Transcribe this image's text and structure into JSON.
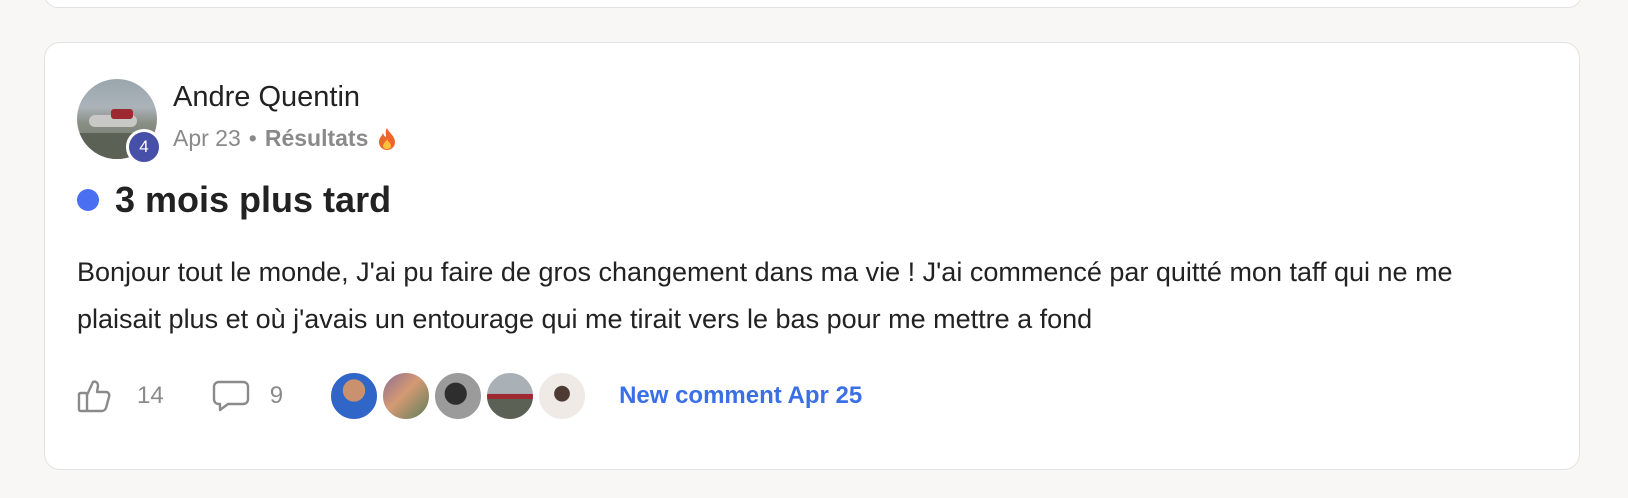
{
  "post": {
    "author": {
      "name": "Andre Quentin",
      "level": "4"
    },
    "date": "Apr 23",
    "separator": "•",
    "category": "Résultats",
    "category_icon": "fire-icon",
    "title": "3 mois plus tard",
    "body": "Bonjour tout le monde, J'ai pu faire de gros changement dans ma vie ! J'ai commencé par quitté mon taff qui ne me plaisait plus et où j'avais un entourage qui me tirait vers le bas pour me mettre a fond",
    "likes": "14",
    "comments": "9",
    "commenters_count": 5,
    "new_comment_label": "New comment Apr 25"
  },
  "colors": {
    "accent": "#3b6fe6",
    "unread_dot": "#4a6ff0",
    "level_badge": "#4650a8",
    "muted_text": "#8a8a8a",
    "fire": "#e8661c"
  }
}
